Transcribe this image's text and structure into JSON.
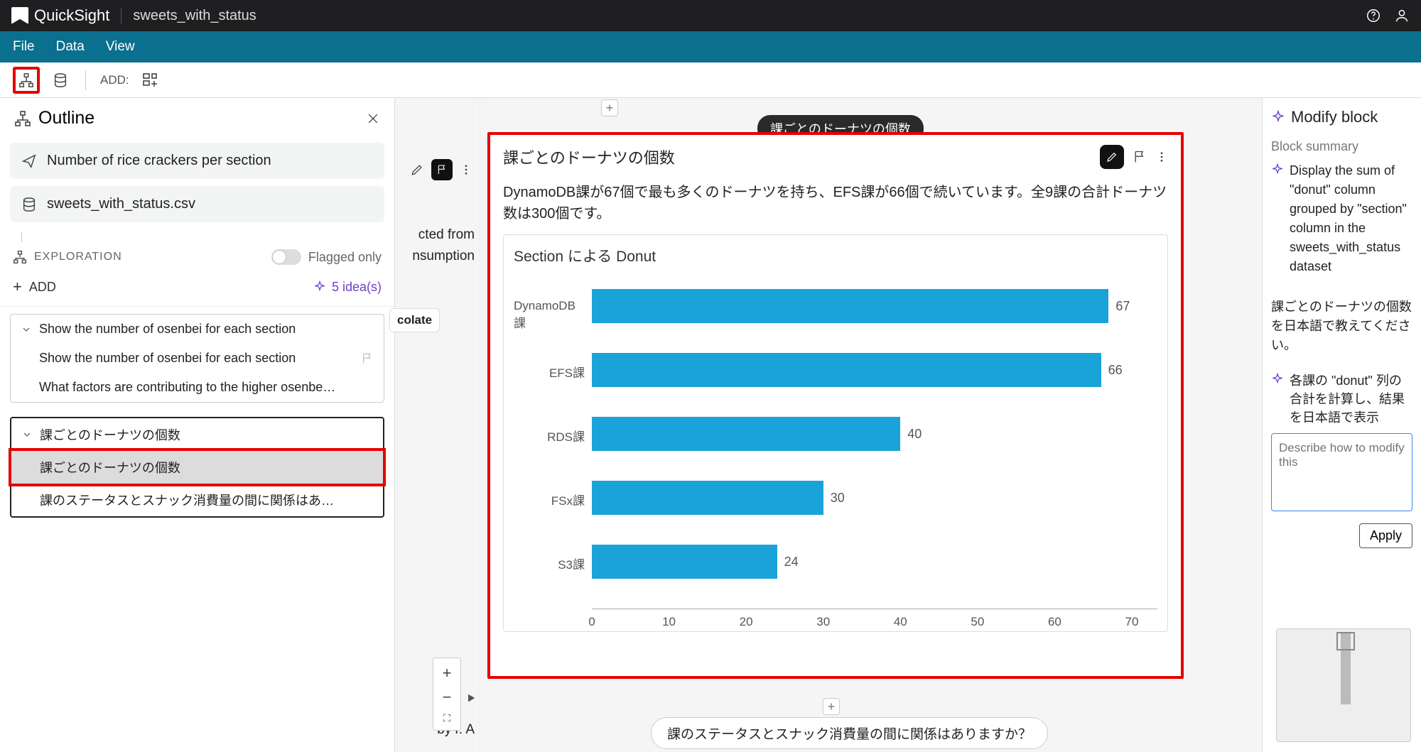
{
  "app": {
    "name": "QuickSight",
    "doc_title": "sweets_with_status"
  },
  "menu": {
    "file": "File",
    "data": "Data",
    "view": "View"
  },
  "toolbar": {
    "add_label": "ADD:"
  },
  "sidebar": {
    "title": "Outline",
    "item_title": "Number of rice crackers per section",
    "dataset": "sweets_with_status.csv",
    "exploration_label": "EXPLORATION",
    "flagged_label": "Flagged only",
    "add_label": "ADD",
    "ideas_label": "5 idea(s)",
    "group1": {
      "header": "Show the number of osenbei for each section",
      "items": [
        "Show the number of osenbei for each section",
        "What factors are contributing to the higher osenbei cons..."
      ]
    },
    "group2": {
      "header": "課ごとのドーナツの個数",
      "items": [
        "課ごとのドーナツの個数",
        "課のステータスとスナック消費量の間に関係はありますか？"
      ]
    }
  },
  "midcol": {
    "partial1a": "cted from",
    "partial1b": "nsumption",
    "partial2": "colate",
    "partial3": "by        r. A"
  },
  "canvas": {
    "tooltip": "課ごとのドーナツの個数",
    "card_title": "課ごとのドーナツの個数",
    "summary": "DynamoDB課が67個で最も多くのドーナツを持ち、EFS課が66個で続いています。全9課の合計ドーナツ数は300個です。",
    "chart_title": "Section による Donut",
    "suggestion": "課のステータスとスナック消費量の間に関係はありますか？"
  },
  "chart_data": {
    "type": "bar",
    "orientation": "horizontal",
    "title": "Section による Donut",
    "categories": [
      "DynamoDB課",
      "EFS課",
      "RDS課",
      "FSx課",
      "S3課"
    ],
    "values": [
      67,
      66,
      40,
      30,
      24
    ],
    "xlim": [
      0,
      70
    ],
    "xticks": [
      0,
      10,
      20,
      30,
      40,
      50,
      60,
      70
    ],
    "xlabel": "",
    "ylabel": ""
  },
  "rightpanel": {
    "title": "Modify block",
    "summary_label": "Block summary",
    "summary_text": "Display the sum of \"donut\" column grouped by \"section\" column in the sweets_with_status dataset",
    "q1": "課ごとのドーナツの個数を日本語で教えてください。",
    "q2": "各課の \"donut\" 列の合計を計算し、結果を日本語で表示",
    "placeholder": "Describe how to modify this",
    "apply": "Apply"
  }
}
